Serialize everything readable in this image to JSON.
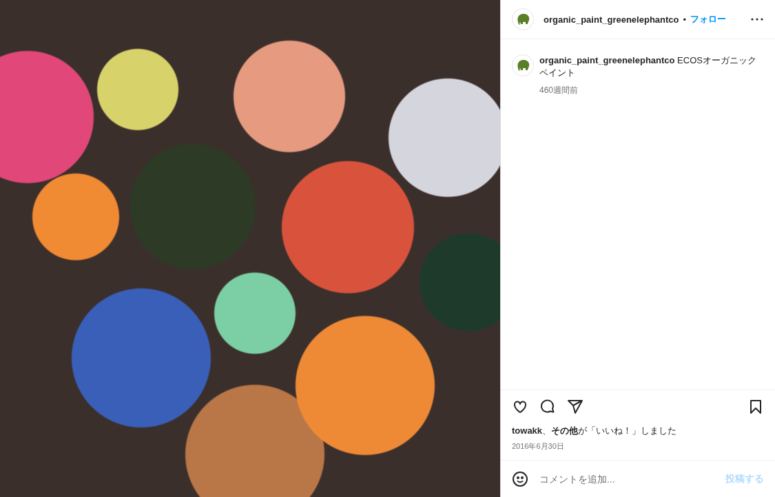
{
  "header": {
    "username": "organic_paint_greenelephantco",
    "separator": "•",
    "follow": "フォロー"
  },
  "caption": {
    "text": "**organic_paint_greenelephantco** ECOSオーガニックペイント",
    "time": "460週間前"
  },
  "likes": "**towakk**、**その他**が「いいね！」しました",
  "date": "2016年6月30日",
  "comment": {
    "placeholder": "コメントを追加...",
    "post_button": "投稿する",
    "post_disabled": true
  }
}
